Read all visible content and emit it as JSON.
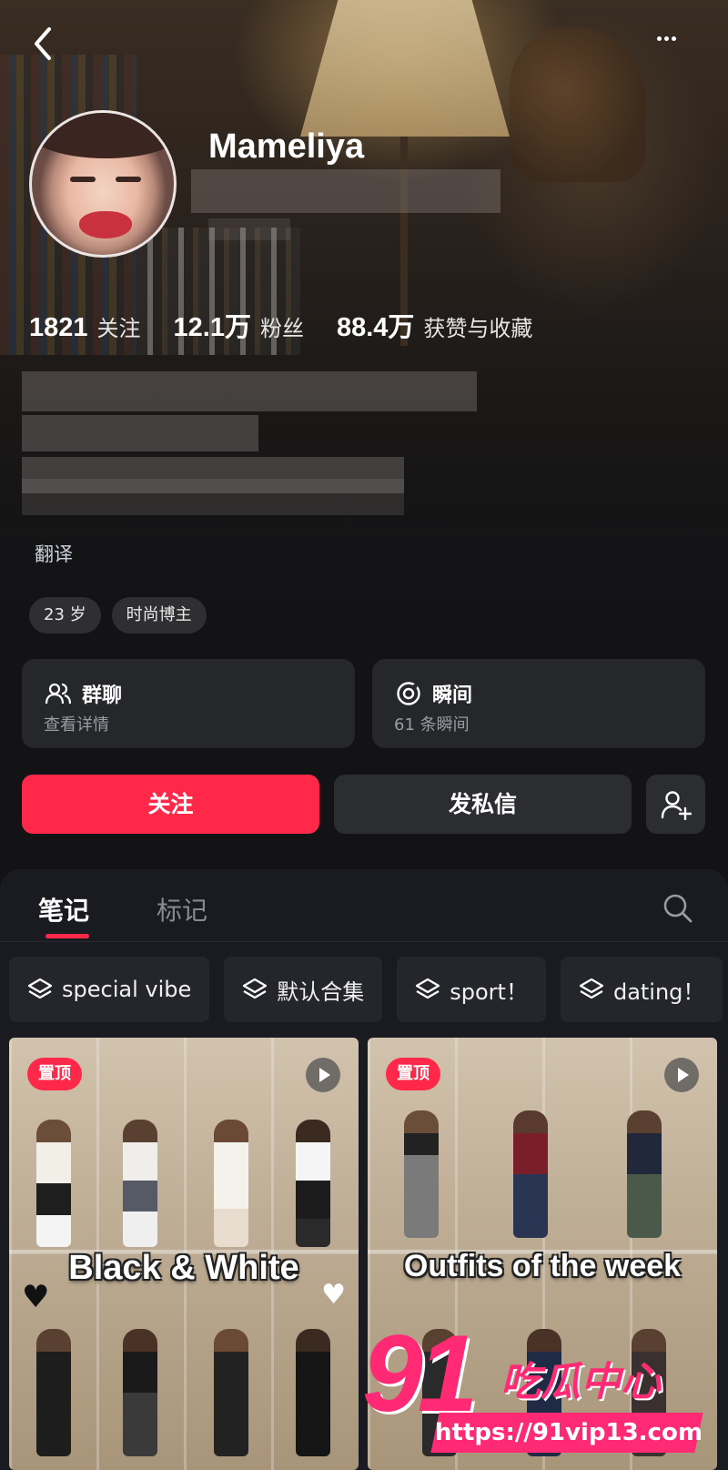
{
  "profile": {
    "username": "Mameliya",
    "stats": [
      {
        "value": "1821",
        "label": "关注"
      },
      {
        "value": "12.1万",
        "label": "粉丝"
      },
      {
        "value": "88.4万",
        "label": "获赞与收藏"
      }
    ],
    "translate_label": "翻译",
    "tags": [
      "23 岁",
      "时尚博主"
    ]
  },
  "cards": {
    "group_chat": {
      "title": "群聊",
      "subtitle": "查看详情"
    },
    "moments": {
      "title": "瞬间",
      "subtitle": "61 条瞬间"
    }
  },
  "actions": {
    "follow_label": "关注",
    "message_label": "发私信"
  },
  "tabs": {
    "notes": "笔记",
    "marks": "标记"
  },
  "collections": [
    "special vibe",
    "默认合集",
    "sport！",
    "dating！"
  ],
  "posts": [
    {
      "pin_label": "置顶",
      "caption": "Black & White"
    },
    {
      "pin_label": "置顶",
      "caption": "Outfits of the week"
    }
  ],
  "watermark": {
    "number": "91",
    "text": "吃瓜中心",
    "url": "https://91vip13.com"
  },
  "colors": {
    "accent": "#ff2849",
    "watermark": "#ff2a73",
    "card_bg": "#26272b"
  }
}
